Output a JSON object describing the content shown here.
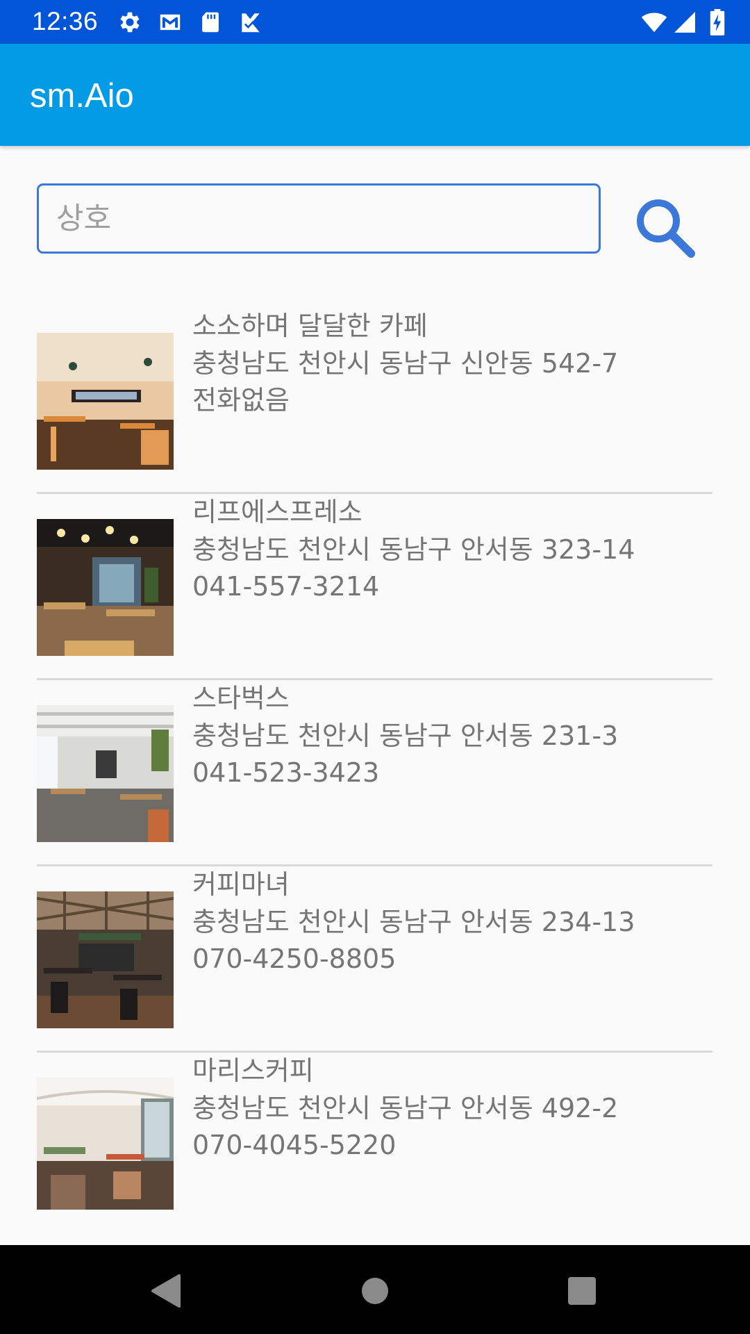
{
  "status_bar": {
    "time": "12:36",
    "icons_left": [
      "settings-icon",
      "gmail-icon",
      "sd-card-icon",
      "task-icon"
    ],
    "icons_right": [
      "wifi-icon",
      "cell-signal-icon",
      "battery-charging-icon"
    ]
  },
  "app_bar": {
    "title": "sm.Aio"
  },
  "search": {
    "placeholder": "상호",
    "value": ""
  },
  "stores": [
    {
      "name": "소소하며 달달한 카페",
      "address": "충청남도 천안시 동남구 신안동 542-7",
      "phone": "전화없음"
    },
    {
      "name": "리프에스프레소",
      "address": "충청남도 천안시 동남구 안서동 323-14",
      "phone": "041-557-3214"
    },
    {
      "name": "스타벅스",
      "address": "충청남도 천안시 동남구 안서동 231-3",
      "phone": "041-523-3423"
    },
    {
      "name": "커피마녀",
      "address": "충청남도 천안시 동남구 안서동 234-13",
      "phone": "070-4250-8805"
    },
    {
      "name": "마리스커피",
      "address": "충청남도 천안시 동남구 안서동 492-2",
      "phone": "070-4045-5220"
    }
  ],
  "colors": {
    "status_bar": "#0255d6",
    "app_bar": "#039be5",
    "accent": "#3c78d8"
  }
}
